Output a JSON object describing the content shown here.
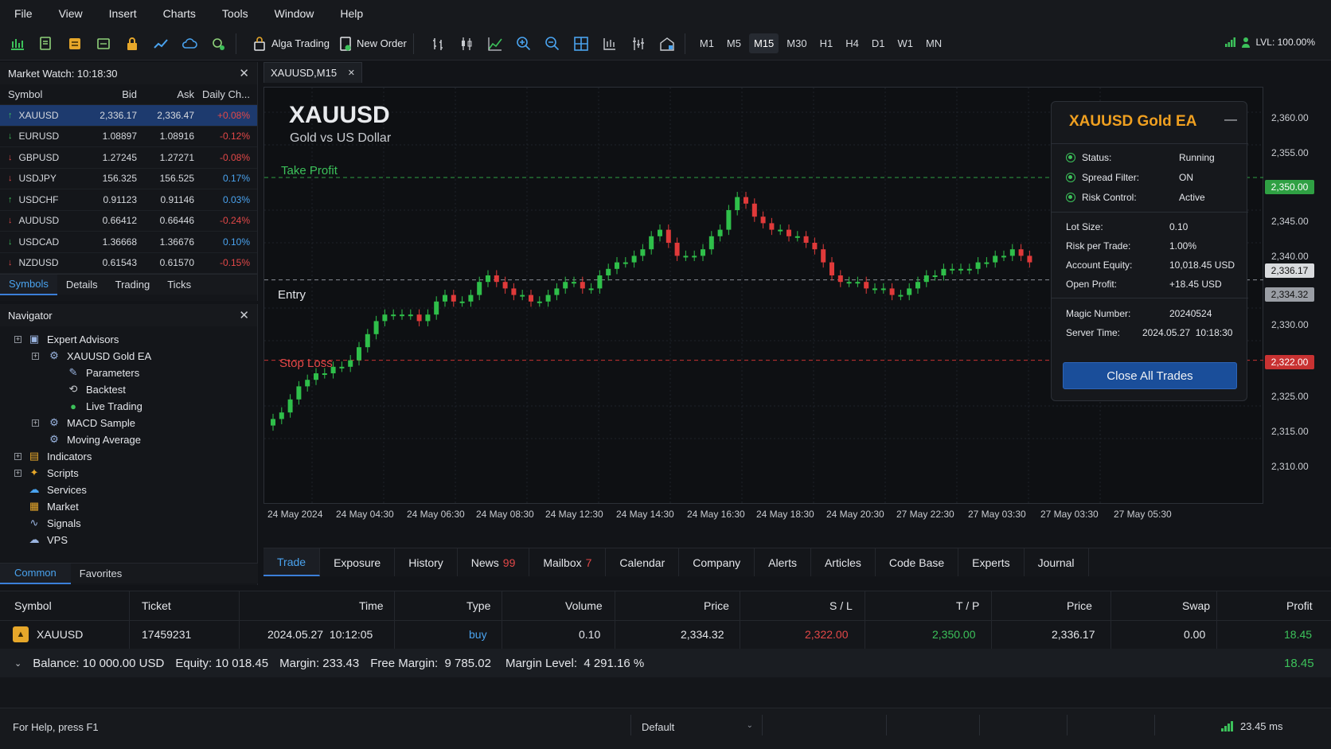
{
  "menu": [
    "File",
    "View",
    "Insert",
    "Charts",
    "Tools",
    "Window",
    "Help"
  ],
  "toolbar": {
    "algo_label": "Alga Trading",
    "new_order_label": "New Order",
    "timeframes": [
      "M1",
      "M5",
      "M15",
      "M30",
      "H1",
      "H4",
      "D1",
      "W1",
      "MN"
    ],
    "active_timeframe": "M15",
    "level_label": "LVL: 100.00%"
  },
  "market_watch": {
    "title": "Market Watch: 10:18:30",
    "headers": {
      "symbol": "Symbol",
      "bid": "Bid",
      "ask": "Ask",
      "change": "Daily Ch..."
    },
    "rows": [
      {
        "symbol": "XAUUSD",
        "bid": "2,336.17",
        "ask": "2,336.47",
        "change": "+0.08%",
        "dir": "up",
        "tone": "neg",
        "selected": true
      },
      {
        "symbol": "EURUSD",
        "bid": "1.08897",
        "ask": "1.08916",
        "change": "-0.12%",
        "dir": "down-green",
        "tone": "neg"
      },
      {
        "symbol": "GBPUSD",
        "bid": "1.27245",
        "ask": "1.27271",
        "change": "-0.08%",
        "dir": "down",
        "tone": "neg"
      },
      {
        "symbol": "USDJPY",
        "bid": "156.325",
        "ask": "156.525",
        "change": "0.17%",
        "dir": "down",
        "tone": "pos"
      },
      {
        "symbol": "USDCHF",
        "bid": "0.91123",
        "ask": "0.91146",
        "change": "0.03%",
        "dir": "up",
        "tone": "pos"
      },
      {
        "symbol": "AUDUSD",
        "bid": "0.66412",
        "ask": "0.66446",
        "change": "-0.24%",
        "dir": "down",
        "tone": "neg"
      },
      {
        "symbol": "USDCAD",
        "bid": "1.36668",
        "ask": "1.36676",
        "change": "0.10%",
        "dir": "down-green",
        "tone": "pos"
      },
      {
        "symbol": "NZDUSD",
        "bid": "0.61543",
        "ask": "0.61570",
        "change": "-0.15%",
        "dir": "down",
        "tone": "neg"
      }
    ],
    "tabs": [
      "Symbols",
      "Details",
      "Trading",
      "Ticks"
    ],
    "active_tab": "Symbols"
  },
  "navigator": {
    "title": "Navigator",
    "items": [
      {
        "label": "Expert Advisors",
        "icon": "expert-advisors-icon"
      },
      {
        "label": "XAUUSD Gold EA",
        "icon": "robot-icon"
      },
      {
        "label": "Parameters",
        "icon": "parameters-icon"
      },
      {
        "label": "Backtest",
        "icon": "backtest-icon"
      },
      {
        "label": "Live Trading",
        "icon": "live-trading-icon"
      },
      {
        "label": "MACD Sample",
        "icon": "robot-icon"
      },
      {
        "label": "Moving Average",
        "icon": "robot-icon"
      },
      {
        "label": "Indicators",
        "icon": "indicators-icon"
      },
      {
        "label": "Scripts",
        "icon": "scripts-icon"
      },
      {
        "label": "Services",
        "icon": "services-icon"
      },
      {
        "label": "Market",
        "icon": "market-icon"
      },
      {
        "label": "Signals",
        "icon": "signals-icon"
      },
      {
        "label": "VPS",
        "icon": "vps-icon"
      }
    ],
    "tabs": [
      "Common",
      "Favorites"
    ],
    "active_tab": "Common"
  },
  "chart": {
    "tab_label": "XAUUSD,M15",
    "symbol": "XAUUSD",
    "description": "Gold vs US Dollar",
    "take_profit_label": "Take Profit",
    "entry_label": "Entry",
    "stop_loss_label": "Stop Loss",
    "y_ticks": [
      "2,360.00",
      "2,355.00",
      "2,345.00",
      "2,340.00",
      "2,330.00",
      "2,325.00",
      "2,315.00",
      "2,310.00"
    ],
    "tp_price": "2,350.00",
    "bid_price": "2,336.17",
    "entry_price": "2,334.32",
    "sl_price": "2,322.00",
    "x_ticks": [
      "24 May 2024",
      "24 May 04:30",
      "24 May 06:30",
      "24 May 08:30",
      "24 May 12:30",
      "24 May 14:30",
      "24 May 16:30",
      "24 May 18:30",
      "24 May 20:30",
      "27 May 22:30",
      "27 May 03:30",
      "27 May 03:30",
      "27 May 05:30"
    ]
  },
  "chart_data": {
    "type": "candlestick",
    "title": "XAUUSD",
    "ylim": [
      2305,
      2362
    ],
    "closes": [
      2313,
      2314,
      2316,
      2318,
      2319,
      2320,
      2320,
      2321,
      2321,
      2322,
      2324,
      2326,
      2328,
      2329,
      2329,
      2329,
      2329,
      2328,
      2329,
      2331,
      2332,
      2331,
      2331,
      2332,
      2334,
      2335,
      2334,
      2333,
      2332,
      2332,
      2331,
      2331,
      2332,
      2333,
      2334,
      2334,
      2333,
      2333,
      2335,
      2336,
      2337,
      2337,
      2338,
      2339,
      2341,
      2342,
      2340,
      2338,
      2338,
      2338,
      2339,
      2341,
      2342,
      2345,
      2347,
      2346,
      2344,
      2343,
      2342,
      2342,
      2341,
      2341,
      2340,
      2339,
      2337,
      2335,
      2334,
      2334,
      2334,
      2333,
      2333,
      2333,
      2332,
      2332,
      2333,
      2334,
      2335,
      2335,
      2336,
      2336,
      2336,
      2336,
      2337,
      2337,
      2338,
      2338,
      2339,
      2338,
      2337
    ]
  },
  "ea_panel": {
    "title": "XAUUSD Gold EA",
    "status_label": "Status:",
    "status_value": "Running",
    "spread_label": "Spread Filter:",
    "spread_value": "ON",
    "risk_label": "Risk Control:",
    "risk_value": "Active",
    "lot_label": "Lot Size:",
    "lot_value": "0.10",
    "risk_trade_label": "Risk per Trade:",
    "risk_trade_value": "1.00%",
    "equity_label": "Account Equity:",
    "equity_value": "10,018.45 USD",
    "profit_label": "Open Profit:",
    "profit_value": "+18.45 USD",
    "magic_label": "Magic Number:",
    "magic_value": "20240524",
    "server_label": "Server Time:",
    "server_value": "2024.05.27  10:18:30",
    "close_button": "Close All Trades"
  },
  "terminal": {
    "tabs": [
      {
        "label": "Trade"
      },
      {
        "label": "Exposure"
      },
      {
        "label": "History"
      },
      {
        "label": "News",
        "count": "99"
      },
      {
        "label": "Mailbox",
        "count": "7"
      },
      {
        "label": "Calendar"
      },
      {
        "label": "Company"
      },
      {
        "label": "Alerts"
      },
      {
        "label": "Articles"
      },
      {
        "label": "Code Base"
      },
      {
        "label": "Experts"
      },
      {
        "label": "Journal"
      }
    ],
    "active_tab": "Trade",
    "headers": {
      "symbol": "Symbol",
      "ticket": "Ticket",
      "time": "Time",
      "type": "Type",
      "volume": "Volume",
      "price": "Price",
      "sl": "S / L",
      "tp": "T / P",
      "cur_price": "Price",
      "swap": "Swap",
      "profit": "Profit"
    },
    "row": {
      "symbol": "XAUUSD",
      "ticket": "17459231",
      "time": "2024.05.27  10:12:05",
      "type": "buy",
      "volume": "0.10",
      "price": "2,334.32",
      "sl": "2,322.00",
      "tp": "2,350.00",
      "cur_price": "2,336.17",
      "swap": "0.00",
      "profit": "18.45"
    },
    "balance": {
      "balance": "Balance: 10 000.00 USD",
      "equity": "Equity: 10 018.45",
      "margin": "Margin: 233.43",
      "free": "Free Margin:  9 785.02",
      "level": "Margin Level:  4 291.16 %",
      "profit": "18.45"
    }
  },
  "status_bar": {
    "help": "For Help, press F1",
    "profile": "Default",
    "ping": "23.45 ms"
  },
  "colors": {
    "up": "#2fbf4a",
    "down": "#e03a3a",
    "accent": "#3b7fd9",
    "ea_title": "#f0a020"
  }
}
